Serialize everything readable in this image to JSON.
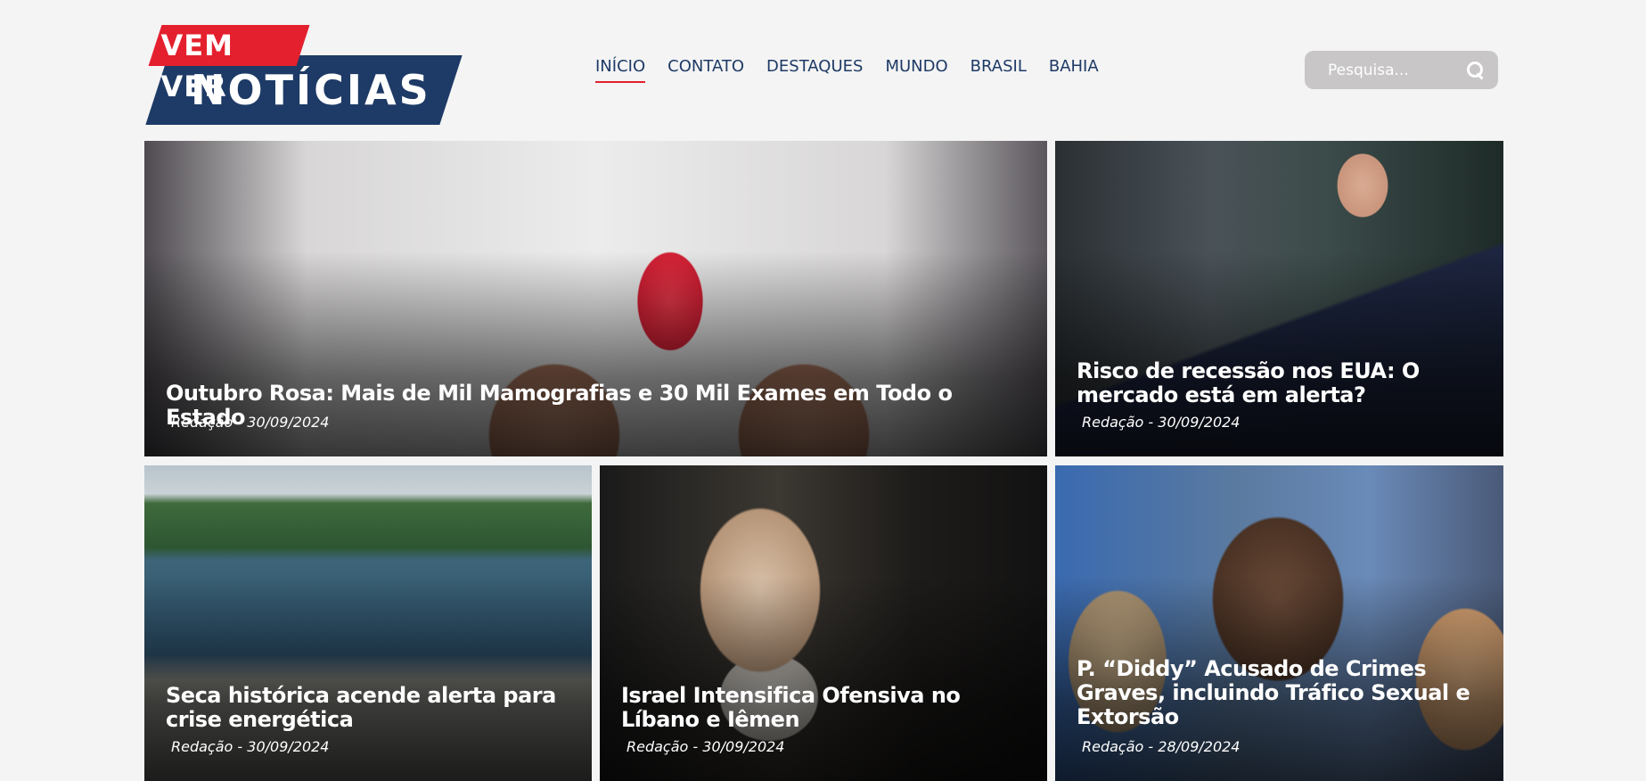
{
  "header": {
    "logo": {
      "line1": "VEM VER",
      "line2": "NOTÍCIAS"
    },
    "nav": [
      {
        "label": "INÍCIO",
        "active": true
      },
      {
        "label": "CONTATO"
      },
      {
        "label": "DESTAQUES"
      },
      {
        "label": "MUNDO"
      },
      {
        "label": "BRASIL"
      },
      {
        "label": "BAHIA"
      }
    ],
    "search": {
      "placeholder": "Pesquisa...",
      "icon": "search-icon"
    }
  },
  "colors": {
    "brand_red": "#e4202e",
    "brand_navy": "#1e3a66",
    "search_bg": "#c8c6c6",
    "page_bg": "#f4f4f4"
  },
  "articles": [
    {
      "title": "Outubro Rosa: Mais de Mil Mamografias e 30 Mil Exames em Todo o Estado",
      "author": "Redação",
      "date": "30/09/2024"
    },
    {
      "title": "Risco de recessão nos EUA: O mercado está em alerta?",
      "author": "Redação",
      "date": "30/09/2024"
    },
    {
      "title": "Seca histórica acende alerta para crise energética",
      "author": "Redação",
      "date": "30/09/2024"
    },
    {
      "title": "Israel Intensifica Ofensiva no Líbano e Iêmen",
      "author": "Redação",
      "date": "30/09/2024"
    },
    {
      "title": "P. “Diddy” Acusado de Crimes Graves, incluindo Tráfico Sexual e Extorsão",
      "author": "Redação",
      "date": "28/09/2024"
    }
  ]
}
